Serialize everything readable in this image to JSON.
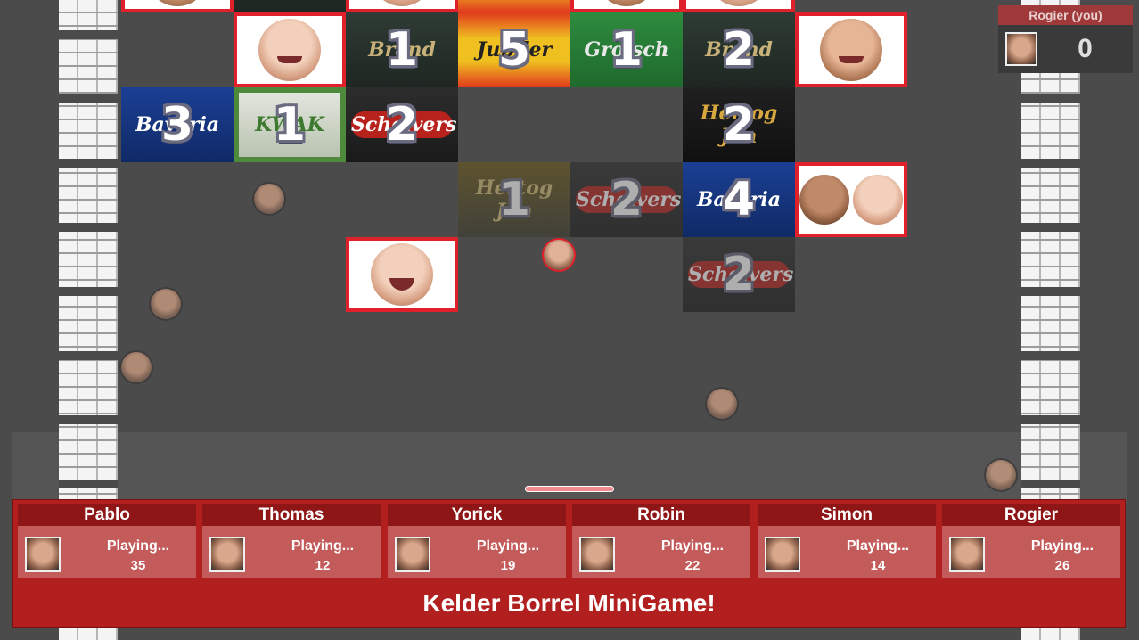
{
  "hud": {
    "player_name": "Rogier (you)",
    "score": "0"
  },
  "bricks": {
    "r1c3": {
      "num": "1",
      "label": "Brand"
    },
    "r1c4": {
      "num": "5",
      "label": "Jupiler"
    },
    "r1c5": {
      "num": "1",
      "label": "Grolsch"
    },
    "r1c6": {
      "num": "2",
      "label": "Brand"
    },
    "r2c0": {
      "num": "3",
      "label": "Bavaria"
    },
    "r2c1": {
      "num": "1",
      "label": "KWAK"
    },
    "r2c2": {
      "num": "2",
      "label": "Schelvers"
    },
    "r2c6": {
      "num": "2",
      "label": "Hertog Jan"
    },
    "r3c4": {
      "num": "1",
      "label": "Hertog Jan"
    },
    "r3c5": {
      "num": "2",
      "label": "Schelvers"
    },
    "r3c6": {
      "num": "4",
      "label": "Bavaria"
    },
    "r4c6": {
      "num": "2",
      "label": "Schelvers"
    }
  },
  "players": [
    {
      "name": "Pablo",
      "status": "Playing...",
      "score": "35"
    },
    {
      "name": "Thomas",
      "status": "Playing...",
      "score": "12"
    },
    {
      "name": "Yorick",
      "status": "Playing...",
      "score": "19"
    },
    {
      "name": "Robin",
      "status": "Playing...",
      "score": "22"
    },
    {
      "name": "Simon",
      "status": "Playing...",
      "score": "14"
    },
    {
      "name": "Rogier",
      "status": "Playing...",
      "score": "26"
    }
  ],
  "footer_title": "Kelder Borrel MiniGame!"
}
